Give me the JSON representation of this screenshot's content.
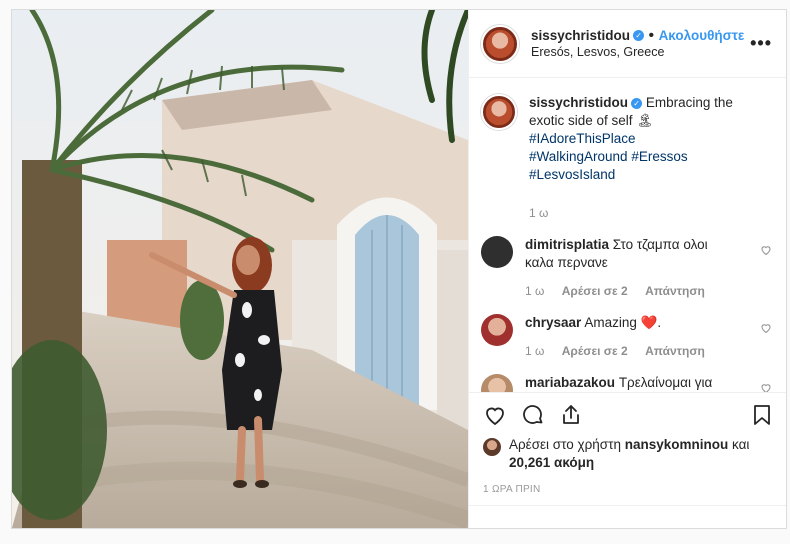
{
  "header": {
    "username": "sissychristidou",
    "separator": "•",
    "follow_label": "Ακολουθήστε",
    "location": "Eresós, Lesvos, Greece",
    "more_icon": "more-options-icon"
  },
  "caption": {
    "username": "sissychristidou",
    "text": "Embracing the exotic side of self",
    "emoji": "🏝",
    "hashtags": [
      "#IAdoreThisPlace",
      "#WalkingAround",
      "#Eressos",
      "#LesvosIsland"
    ],
    "age": "1 ω"
  },
  "comments": [
    {
      "username": "dimitrisplatia",
      "text": "Στο τζαμπα ολοι καλα περνανε",
      "age": "1 ω",
      "likes_label": "Αρέσει σε 2",
      "reply_label": "Απάντηση",
      "avatar_color": "#2f2f2f"
    },
    {
      "username": "chrysaar",
      "text": "Amazing",
      "emoji": "❤️",
      "age": "1 ω",
      "likes_label": "Αρέσει σε 2",
      "reply_label": "Απάντηση",
      "avatar_color": "#a0302e"
    },
    {
      "username": "mariabazakou",
      "text": "Τρελαίνομαι για τα μαγιό σου..το ένα καλύτερο από το άλλο!!!! Κούκλα!!",
      "emoji": "👏👏",
      "avatar_color": "#b58b6a"
    }
  ],
  "likes": {
    "prefix": "Αρέσει στο χρήστη",
    "user": "nansykomninou",
    "joiner": "και",
    "count": "20,261 ακόμη"
  },
  "posted_time": "1 ΩΡΑ ΠΡΙΝ",
  "colors": {
    "link_blue": "#3897f0",
    "hashtag": "#003569",
    "muted": "#8e8e8e",
    "heart_red": "#ed4956"
  }
}
